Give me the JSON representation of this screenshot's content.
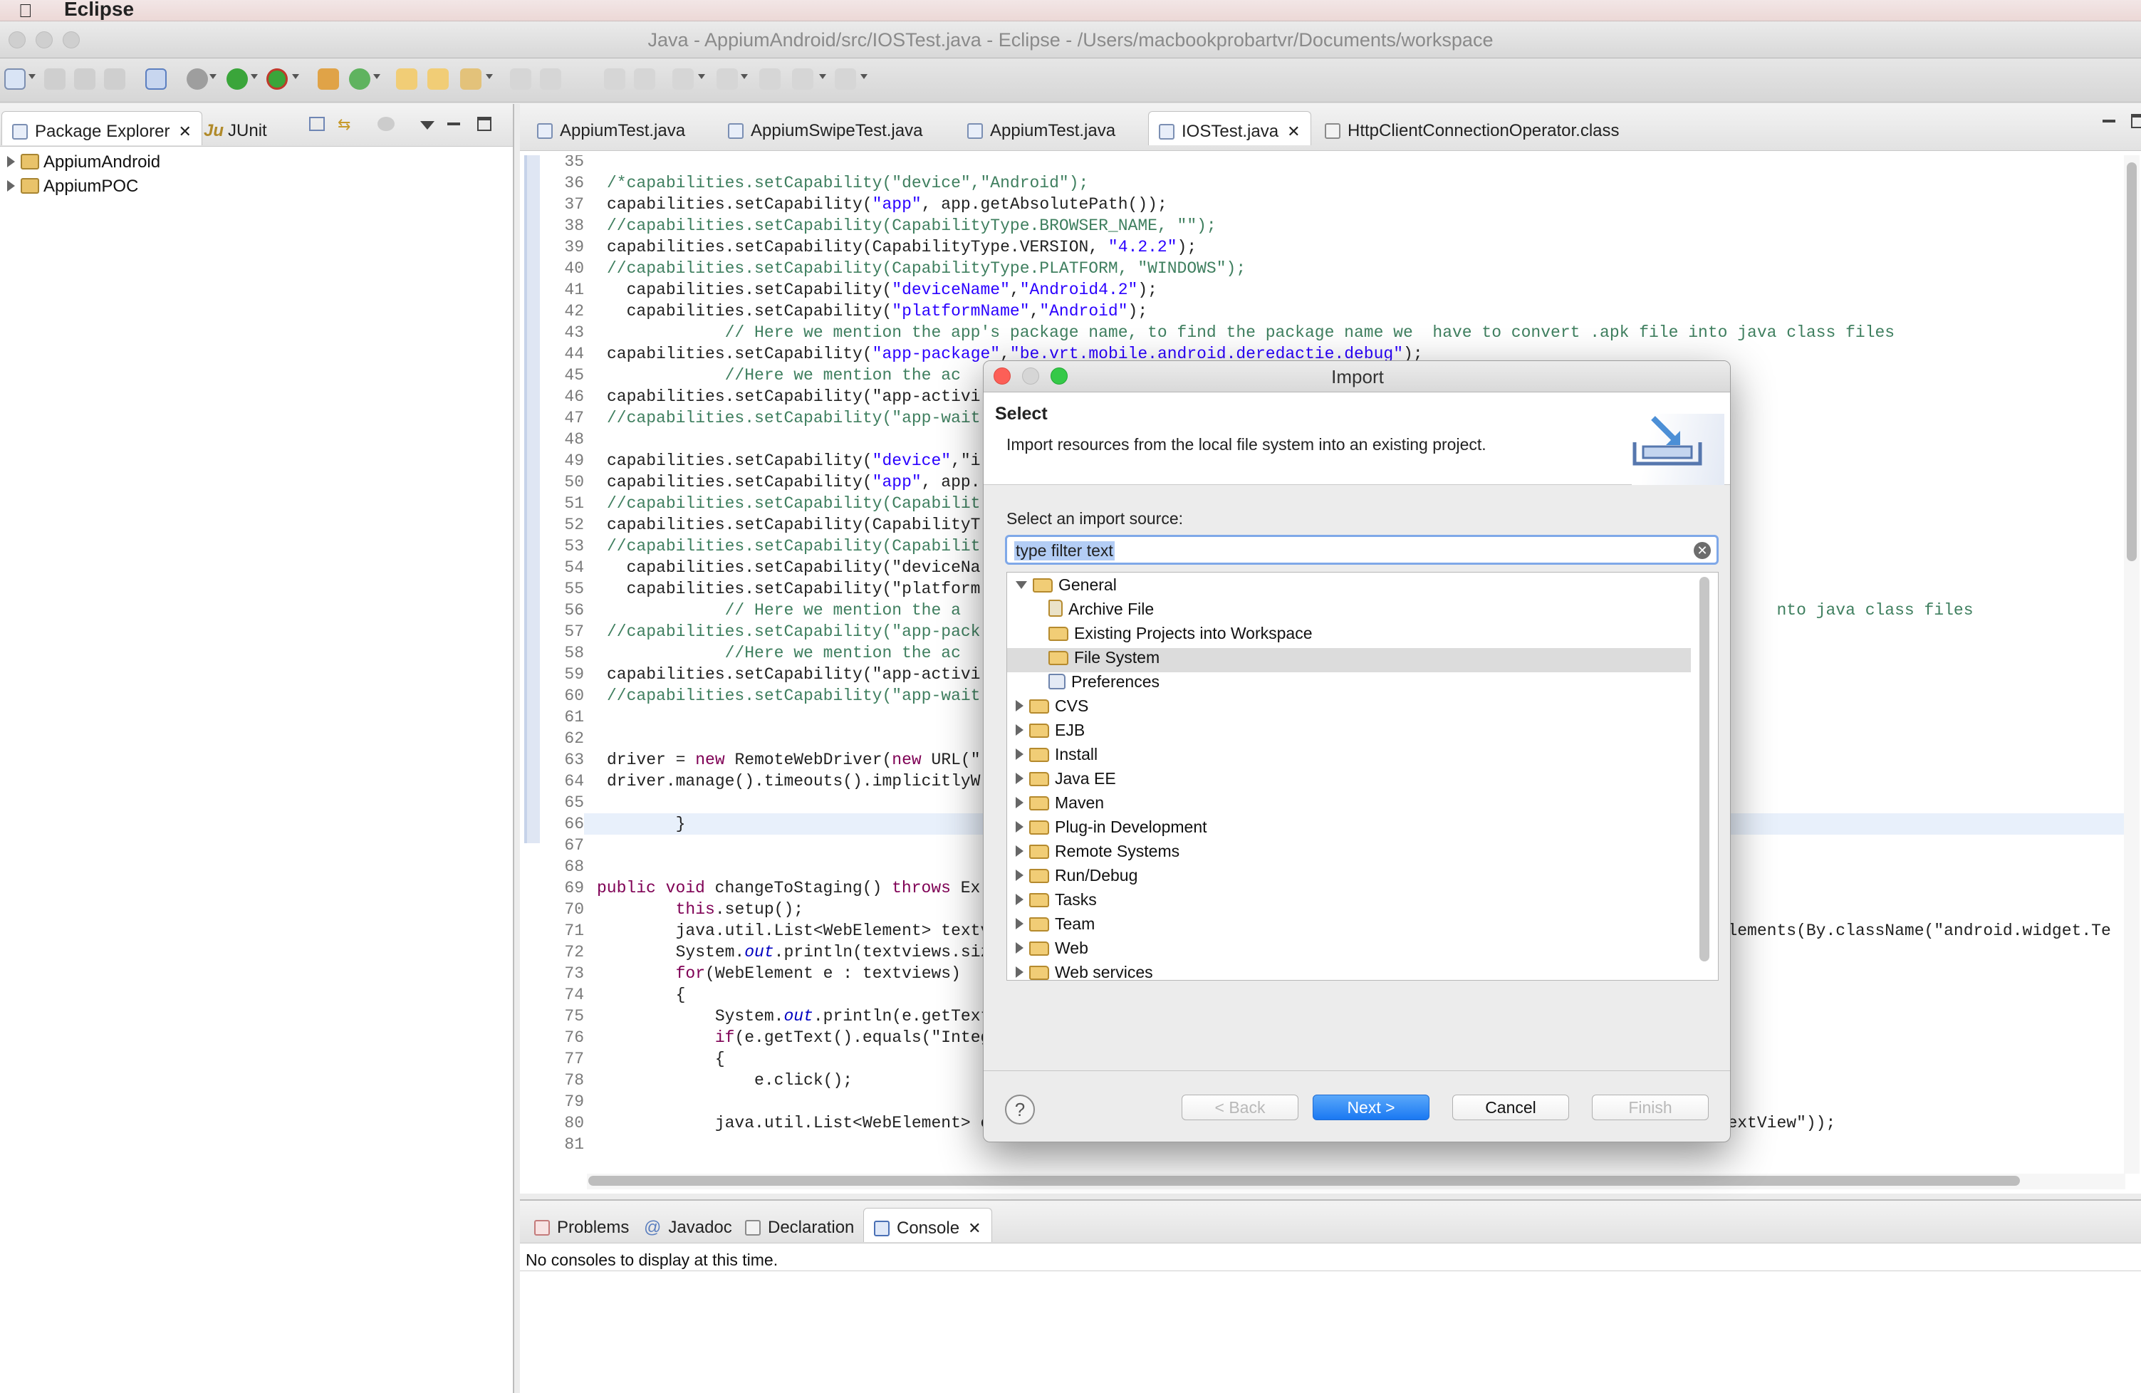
{
  "os_menu": {
    "app_name": "Eclipse"
  },
  "window": {
    "title": "Java - AppiumAndroid/src/IOSTest.java - Eclipse - /Users/macbookprobartvr/Documents/workspace"
  },
  "left_view": {
    "tabs": [
      {
        "label": "Package Explorer",
        "active": true
      },
      {
        "label": "JUnit",
        "active": false
      }
    ],
    "projects": [
      "AppiumAndroid",
      "AppiumPOC"
    ]
  },
  "editor": {
    "tabs": [
      {
        "label": "AppiumTest.java",
        "active": false
      },
      {
        "label": "AppiumSwipeTest.java",
        "active": false
      },
      {
        "label": "AppiumTest.java",
        "active": false
      },
      {
        "label": "IOSTest.java",
        "active": true
      },
      {
        "label": "HttpClientConnectionOperator.class",
        "active": false
      }
    ],
    "lines": [
      {
        "n": "35",
        "t": ""
      },
      {
        "n": "36",
        "t": "/*capabilities.setCapability(\"device\",\"Android\");"
      },
      {
        "n": "37",
        "t": "capabilities.setCapability(\"app\", app.getAbsolutePath());"
      },
      {
        "n": "38",
        "t": "//capabilities.setCapability(CapabilityType.BROWSER_NAME, \"\");"
      },
      {
        "n": "39",
        "t": "capabilities.setCapability(CapabilityType.VERSION, \"4.2.2\");"
      },
      {
        "n": "40",
        "t": "//capabilities.setCapability(CapabilityType.PLATFORM, \"WINDOWS\");"
      },
      {
        "n": "41",
        "t": "  capabilities.setCapability(\"deviceName\",\"Android4.2\");"
      },
      {
        "n": "42",
        "t": "  capabilities.setCapability(\"platformName\",\"Android\");"
      },
      {
        "n": "43",
        "t": "            // Here we mention the app's package name, to find the package name we  have to convert .apk file into java class files"
      },
      {
        "n": "44",
        "t": "capabilities.setCapability(\"app-package\",\"be.vrt.mobile.android.deredactie.debug\");"
      },
      {
        "n": "45",
        "t": "            //Here we mention the ac"
      },
      {
        "n": "46",
        "t": "capabilities.setCapability(\"app-activi"
      },
      {
        "n": "47",
        "t": "//capabilities.setCapability(\"app-wait"
      },
      {
        "n": "48",
        "t": ""
      },
      {
        "n": "49",
        "t": "capabilities.setCapability(\"device\",\"i"
      },
      {
        "n": "50",
        "t": "capabilities.setCapability(\"app\", app."
      },
      {
        "n": "51",
        "t": "//capabilities.setCapability(Capabilit"
      },
      {
        "n": "52",
        "t": "capabilities.setCapability(CapabilityT"
      },
      {
        "n": "53",
        "t": "//capabilities.setCapability(Capabilit"
      },
      {
        "n": "54",
        "t": "  capabilities.setCapability(\"deviceNa"
      },
      {
        "n": "55",
        "t": "  capabilities.setCapability(\"platform"
      },
      {
        "n": "56",
        "t": "            // Here we mention the a                                                                                   nto java class files"
      },
      {
        "n": "57",
        "t": "//capabilities.setCapability(\"app-pack"
      },
      {
        "n": "58",
        "t": "            //Here we mention the ac"
      },
      {
        "n": "59",
        "t": "capabilities.setCapability(\"app-activi"
      },
      {
        "n": "60",
        "t": "//capabilities.setCapability(\"app-wait"
      },
      {
        "n": "61",
        "t": ""
      },
      {
        "n": "62",
        "t": ""
      },
      {
        "n": "63",
        "t": "driver = new RemoteWebDriver(new URL(\""
      },
      {
        "n": "64",
        "t": "driver.manage().timeouts().implicitlyW"
      },
      {
        "n": "65",
        "t": ""
      },
      {
        "n": "66",
        "t": "       }"
      },
      {
        "n": "67",
        "t": ""
      },
      {
        "n": "68",
        "t": ""
      },
      {
        "n": "69",
        "t": "public void changeToStaging() throws Ex"
      },
      {
        "n": "70",
        "t": "       this.setup();"
      },
      {
        "n": "71",
        "t": "       java.util.List<WebElement> textv                                                                          Elements(By.className(\"android.widget.Te"
      },
      {
        "n": "72",
        "t": "       System.out.println(textviews.siz"
      },
      {
        "n": "73",
        "t": "       for(WebElement e : textviews)"
      },
      {
        "n": "74",
        "t": "       {"
      },
      {
        "n": "75",
        "t": "           System.out.println(e.getText"
      },
      {
        "n": "76",
        "t": "           if(e.getText().equals(\"Integ"
      },
      {
        "n": "77",
        "t": "           {"
      },
      {
        "n": "78",
        "t": "               e.click();"
      },
      {
        "n": "79",
        "t": ""
      },
      {
        "n": "80",
        "t": "           java.util.List<WebElement> c                                                                           extView\"));"
      },
      {
        "n": "81",
        "t": ""
      }
    ]
  },
  "bottom_view": {
    "tabs": [
      {
        "label": "Problems",
        "active": false
      },
      {
        "label": "Javadoc",
        "active": false
      },
      {
        "label": "Declaration",
        "active": false
      },
      {
        "label": "Console",
        "active": true
      }
    ],
    "message": "No consoles to display at this time."
  },
  "dialog": {
    "title": "Import",
    "heading": "Select",
    "description": "Import resources from the local file system into an existing project.",
    "source_label": "Select an import source:",
    "filter_value": "type filter text",
    "tree": [
      {
        "label": "General",
        "level": 0,
        "expanded": true,
        "kind": "folder"
      },
      {
        "label": "Archive File",
        "level": 1,
        "kind": "archive"
      },
      {
        "label": "Existing Projects into Workspace",
        "level": 1,
        "kind": "project"
      },
      {
        "label": "File System",
        "level": 1,
        "kind": "folder",
        "selected": true
      },
      {
        "label": "Preferences",
        "level": 1,
        "kind": "prefs"
      },
      {
        "label": "CVS",
        "level": 0,
        "kind": "folder"
      },
      {
        "label": "EJB",
        "level": 0,
        "kind": "folder"
      },
      {
        "label": "Install",
        "level": 0,
        "kind": "folder"
      },
      {
        "label": "Java EE",
        "level": 0,
        "kind": "folder"
      },
      {
        "label": "Maven",
        "level": 0,
        "kind": "folder"
      },
      {
        "label": "Plug-in Development",
        "level": 0,
        "kind": "folder"
      },
      {
        "label": "Remote Systems",
        "level": 0,
        "kind": "folder"
      },
      {
        "label": "Run/Debug",
        "level": 0,
        "kind": "folder"
      },
      {
        "label": "Tasks",
        "level": 0,
        "kind": "folder"
      },
      {
        "label": "Team",
        "level": 0,
        "kind": "folder"
      },
      {
        "label": "Web",
        "level": 0,
        "kind": "folder"
      },
      {
        "label": "Web services",
        "level": 0,
        "kind": "folder"
      }
    ],
    "buttons": {
      "help": "?",
      "back": "< Back",
      "next": "Next >",
      "cancel": "Cancel",
      "finish": "Finish"
    }
  },
  "colors": {
    "accent": "#1a78f2",
    "selection": "#dcdcdc",
    "comment": "#3f7f5f",
    "string": "#2a00ff",
    "keyword": "#7f0055"
  }
}
